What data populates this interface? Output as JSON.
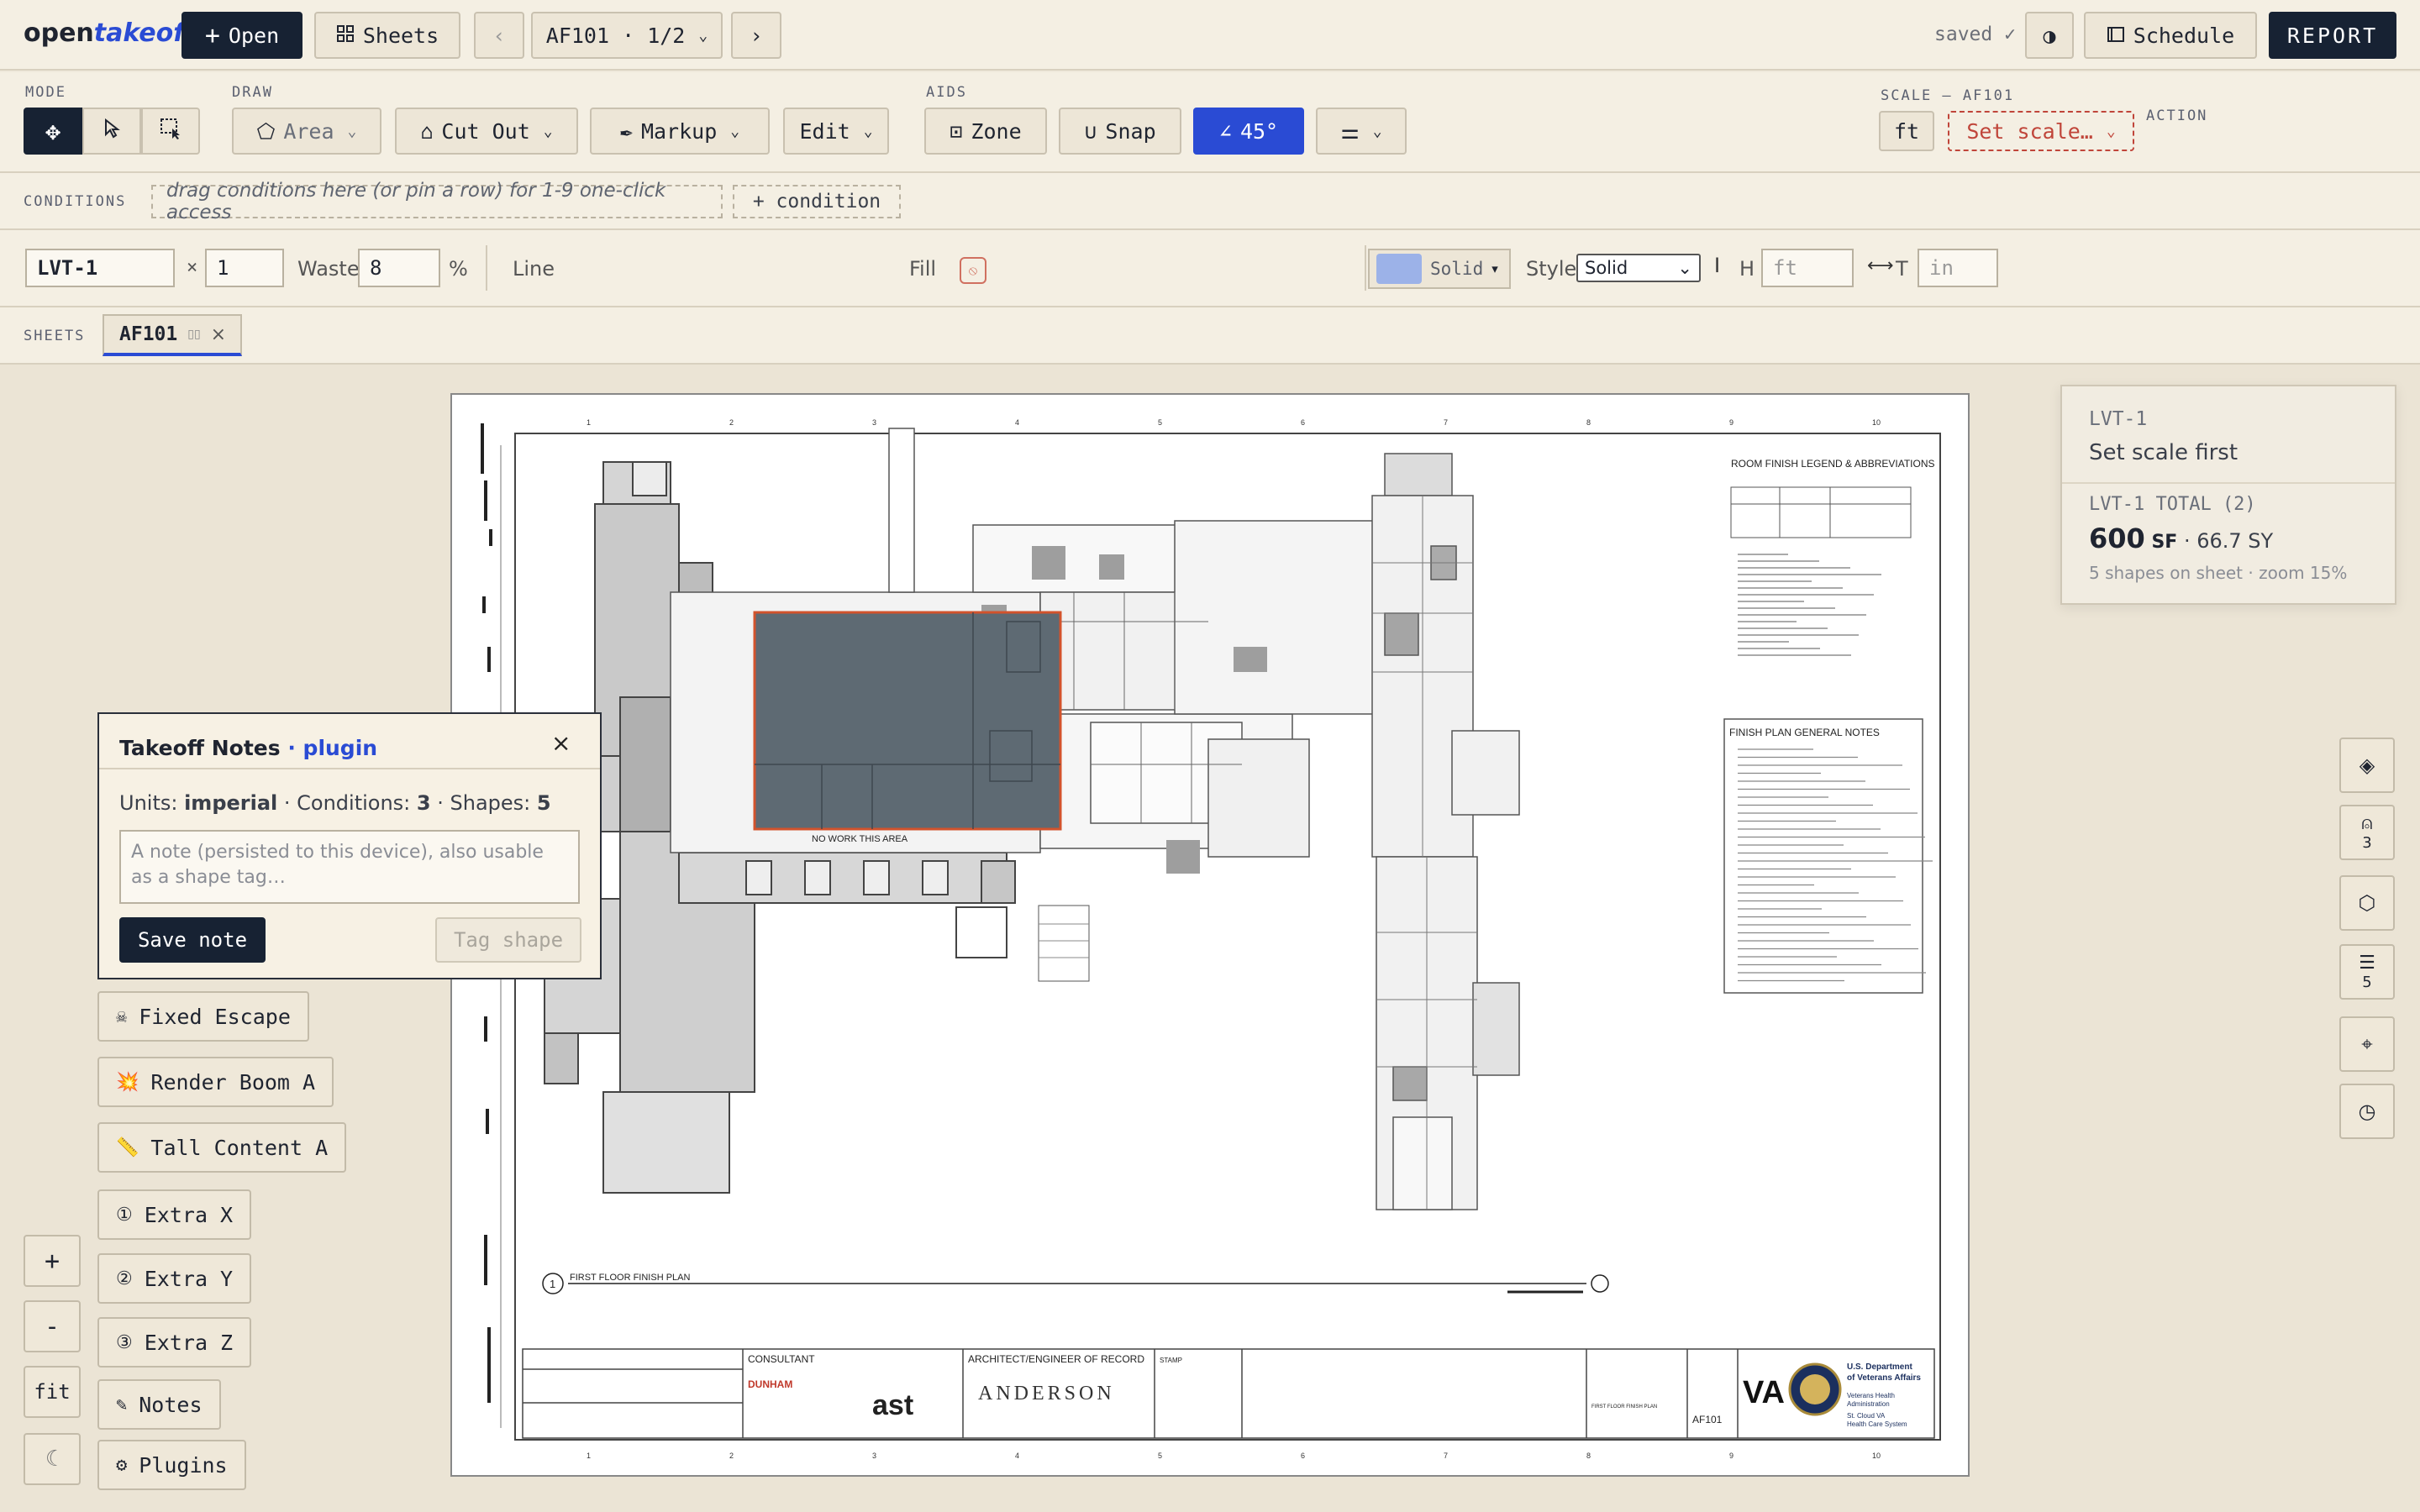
{
  "app": {
    "name_part1": "open",
    "name_part2": "takeoff"
  },
  "topbar": {
    "open_label": "Open",
    "sheets_label": "Sheets",
    "current_sheet": "AF101 · 1/2",
    "saved_label": "saved ✓",
    "schedule_label": "Schedule",
    "report_label": "REPORT"
  },
  "toolbar": {
    "mode_label": "MODE",
    "draw_label": "DRAW",
    "aids_label": "AIDS",
    "scale_label": "SCALE — AF101",
    "action_label": "ACTION",
    "area_label": "Area",
    "cutout_label": "Cut Out",
    "markup_label": "Markup",
    "edit_label": "Edit",
    "zone_label": "Zone",
    "snap_label": "Snap",
    "angle_label": "45°",
    "unit_label": "ft",
    "set_scale_label": "Set scale…"
  },
  "conditions": {
    "label": "CONDITIONS",
    "hint": "drag conditions here (or pin a row) for 1-9 one-click access",
    "add_label": "+ condition"
  },
  "props": {
    "condition_name": "LVT-1",
    "multiplier_symbol": "×",
    "multiplier": "1",
    "waste_label": "Waste",
    "waste_value": "8",
    "percent": "%",
    "line_label": "Line",
    "fill_label": "Fill",
    "fill_mode": "Solid",
    "style_label": "Style",
    "style_value": "Solid",
    "h_label": "H",
    "h_placeholder": "ft",
    "t_label": "T",
    "t_placeholder": "in",
    "line_colors": [
      "#c9643e",
      "#3f8a52",
      "#2a4bd4",
      "#8f4fd6",
      "#c58f1b",
      "#1f9a8a",
      "#c3306f",
      "#2d3644",
      "#d63a3a",
      "#2592b8"
    ],
    "fill_colors": [
      "#e9ab8d",
      "#9cc0a0",
      "#93a9e6",
      "#c8a4eb",
      "#dfc07a",
      "#8fcdc2",
      "#e294b5",
      "#8a9099",
      "#eb8e86",
      "#88c7d8"
    ],
    "fill_preview_color": "#9cb2e8"
  },
  "sheets_bar": {
    "label": "SHEETS",
    "tab_label": "AF101"
  },
  "notes": {
    "title": "Takeoff Notes",
    "title_sep": " · ",
    "plugin_label": "plugin",
    "units_label": "Units: ",
    "units_value": "imperial",
    "conditions_label": " · Conditions: ",
    "conditions_value": "3",
    "shapes_label": " · Shapes: ",
    "shapes_value": "5",
    "placeholder": "A note (persisted to this device), also usable as a shape tag…",
    "save_label": "Save note",
    "tag_label": "Tag shape"
  },
  "side_buttons": [
    {
      "icon": "☠",
      "label": "Fixed Escape"
    },
    {
      "icon": "💥",
      "label": "Render Boom A"
    },
    {
      "icon": "📏",
      "label": "Tall Content A"
    },
    {
      "icon": "①",
      "label": "Extra X"
    },
    {
      "icon": "②",
      "label": "Extra Y"
    },
    {
      "icon": "③",
      "label": "Extra Z"
    },
    {
      "icon": "✎",
      "label": "Notes"
    },
    {
      "icon": "⚙",
      "label": "Plugins"
    }
  ],
  "zoom": {
    "in": "+",
    "out": "-",
    "fit": "fit",
    "theme": "☾"
  },
  "rail": {
    "conditions_count": "3",
    "shapes_count": "5"
  },
  "info_panel": {
    "condition": "LVT-1",
    "status": "Set scale first",
    "total_label": "LVT-1 TOTAL (2)",
    "area_value": "600",
    "area_unit": "SF",
    "sy_value": " · 66.7 SY",
    "footer": "5 shapes on sheet · zoom 15%"
  },
  "drawing": {
    "no_work_label": "NO WORK THIS AREA",
    "plan_title": "FIRST FLOOR FINISH PLAN",
    "plan_number": "1",
    "legend_title": "ROOM FINISH LEGEND & ABBREVIATIONS",
    "general_notes_title": "FINISH PLAN GENERAL NOTES",
    "consultant_label": "CONSULTANT",
    "architect_label": "ARCHITECT/ENGINEER OF RECORD",
    "stamp_label": "STAMP",
    "consultant_name": "DUNHAM",
    "consultant2_name": "ast",
    "architect_name": "ANDERSON",
    "va_label": "VA",
    "va_dept": "U.S. Department of Veterans Affairs",
    "va_admin": "Veterans Health Administration",
    "va_site": "St. Cloud VA Health Care System",
    "drawing_number": "AF101",
    "drawing_title": "FIRST FLOOR FINISH PLAN",
    "grid_top": [
      "1",
      "2",
      "3",
      "4",
      "5",
      "6",
      "7",
      "8",
      "9",
      "10"
    ],
    "highlight_color": "#5e6a73",
    "highlight_border": "#d2532c"
  }
}
